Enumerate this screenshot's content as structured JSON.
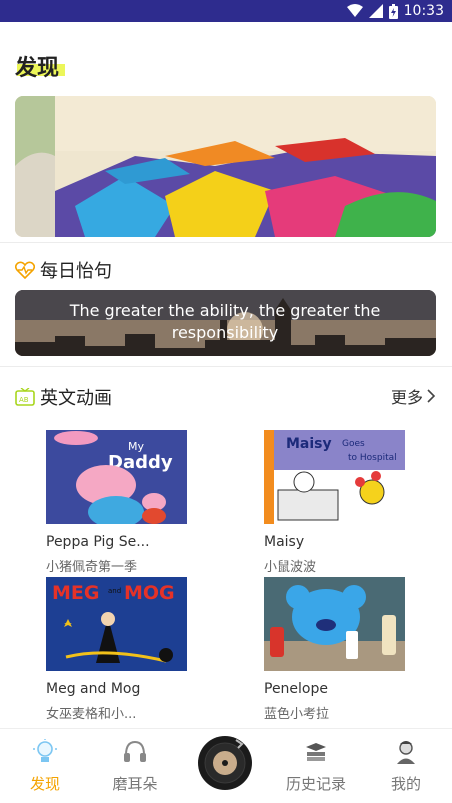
{
  "status_bar": {
    "time": "10:33"
  },
  "page": {
    "title": "发现"
  },
  "daily_quote": {
    "heading": "每日怡句",
    "text": "The greater the ability, the greater the responsibility"
  },
  "cartoons": {
    "heading": "英文动画",
    "more_label": "更多",
    "items": [
      {
        "title": "Peppa Pig Se...",
        "subtitle": "小猪佩奇第一季"
      },
      {
        "title": "Maisy",
        "subtitle": "小鼠波波"
      },
      {
        "title": "Meg and Mog",
        "subtitle": "女巫麦格和小..."
      },
      {
        "title": "Penelope",
        "subtitle": "蓝色小考拉"
      }
    ]
  },
  "bottom_nav": {
    "items": [
      {
        "label": "发现",
        "active": true
      },
      {
        "label": "磨耳朵",
        "active": false
      },
      {
        "label": "历史记录",
        "active": false
      },
      {
        "label": "我的",
        "active": false
      }
    ]
  },
  "colors": {
    "status_bar": "#2e2c8e",
    "accent": "#f4a300",
    "title_highlight": "#e9f53c"
  },
  "icons": [
    "wifi-icon",
    "signal-icon",
    "battery-icon",
    "heart-pulse-icon",
    "tv-icon",
    "chevron-right-icon",
    "lightbulb-icon",
    "headphones-icon",
    "record-disc-icon",
    "books-icon",
    "avatar-icon"
  ]
}
